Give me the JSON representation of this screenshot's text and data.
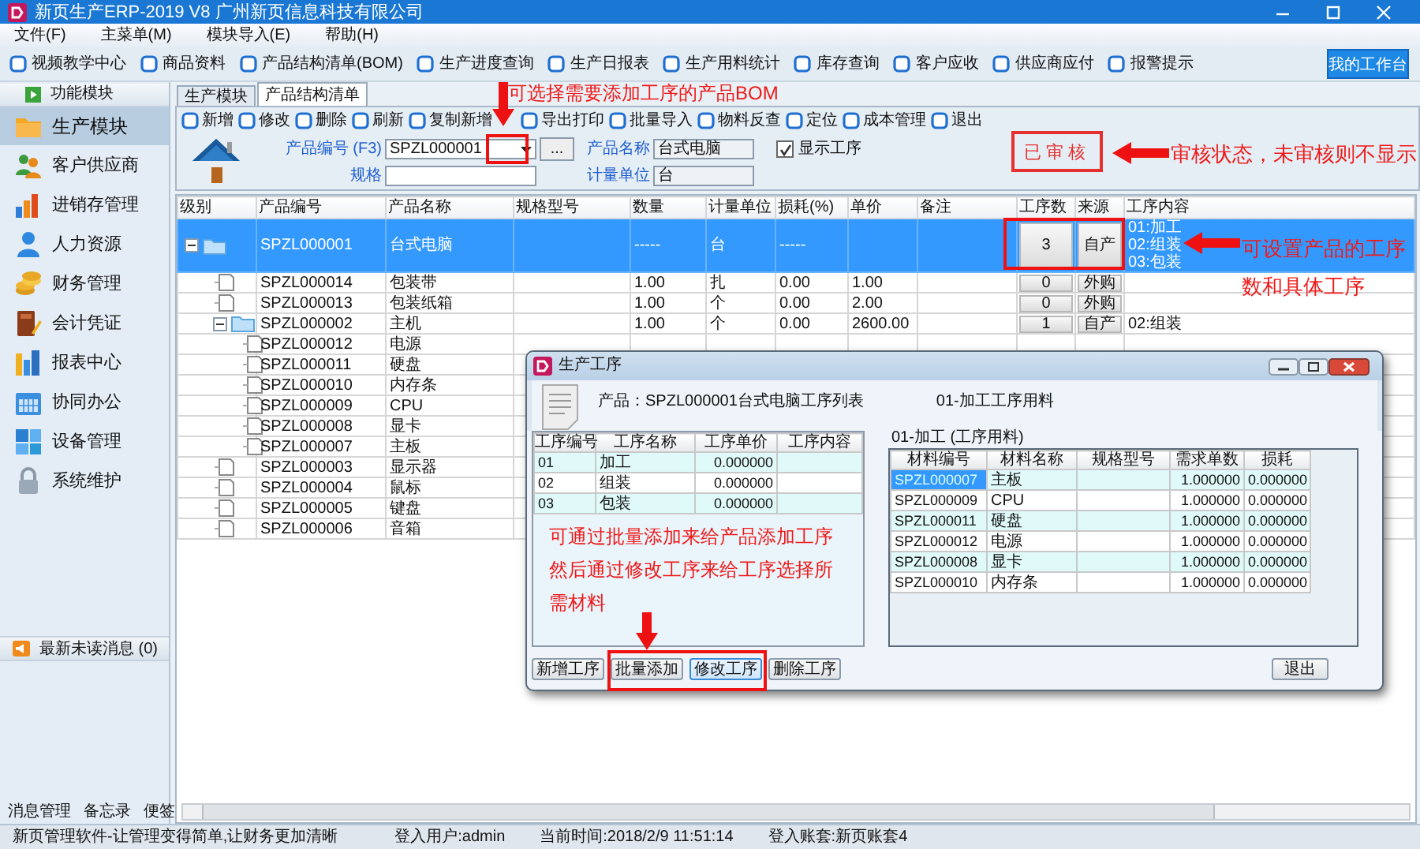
{
  "window": {
    "title": "新页生产ERP-2019 V8 广州新页信息科技有限公司"
  },
  "menu": [
    "文件(F)",
    "主菜单(M)",
    "模块导入(E)",
    "帮助(H)"
  ],
  "toolbar": [
    "视频教学中心",
    "商品资料",
    "产品结构清单(BOM)",
    "生产进度查询",
    "生产日报表",
    "生产用料统计",
    "库存查询",
    "客户应收",
    "供应商应付",
    "报警提示"
  ],
  "workbench_button": "我的工作台",
  "sidebar": {
    "header": "功能模块",
    "items": [
      {
        "label": "生产模块",
        "selected": true
      },
      {
        "label": "客户供应商",
        "selected": false
      },
      {
        "label": "进销存管理",
        "selected": false
      },
      {
        "label": "人力资源",
        "selected": false
      },
      {
        "label": "财务管理",
        "selected": false
      },
      {
        "label": "会计凭证",
        "selected": false
      },
      {
        "label": "报表中心",
        "selected": false
      },
      {
        "label": "协同办公",
        "selected": false
      },
      {
        "label": "设备管理",
        "selected": false
      },
      {
        "label": "系统维护",
        "selected": false
      }
    ],
    "message": "最新未读消息 (0)",
    "footer": [
      "消息管理",
      "备忘录",
      "便签"
    ]
  },
  "tabs": [
    {
      "label": "生产模块",
      "selected": false
    },
    {
      "label": "产品结构清单",
      "selected": true
    }
  ],
  "actions": [
    "新增",
    "修改",
    "删除",
    "刷新",
    "复制新增",
    "导出打印",
    "批量导入",
    "物料反查",
    "定位",
    "成本管理",
    "退出"
  ],
  "form": {
    "code_label": "产品编号 (F3)",
    "code": "SPZL000001",
    "picker": "...",
    "spec_label": "规格",
    "name_label": "产品名称",
    "name": "台式电脑",
    "unit_label": "计量单位",
    "unit": "台",
    "show_process": {
      "label": "显示工序",
      "checked": true
    }
  },
  "audit_stamp": "已审核",
  "table": {
    "columns": [
      "级别",
      "产品编号",
      "产品名称",
      "规格型号",
      "数量",
      "计量单位",
      "损耗(%)",
      "单价",
      "备注",
      "工序数",
      "来源",
      "工序内容"
    ],
    "rows": [
      {
        "kind": "folder",
        "code": "SPZL000001",
        "name": "台式电脑",
        "qty": "-----",
        "unit": "台",
        "loss": "-----",
        "count": "3",
        "source": "自产",
        "process": [
          "01:加工",
          "02:组装",
          "03:包装"
        ],
        "selected": true,
        "expanded": true,
        "children": [
          {
            "kind": "item",
            "code": "SPZL000014",
            "name": "包装带",
            "qty": "1.00",
            "unit": "扎",
            "loss": "0.00",
            "price": "1.00",
            "count": "0",
            "source": "外购",
            "selected": false
          },
          {
            "kind": "item",
            "code": "SPZL000013",
            "name": "包装纸箱",
            "qty": "1.00",
            "unit": "个",
            "loss": "0.00",
            "price": "2.00",
            "count": "0",
            "source": "外购",
            "selected": false
          },
          {
            "kind": "folder",
            "code": "SPZL000002",
            "name": "主机",
            "qty": "1.00",
            "unit": "个",
            "loss": "0.00",
            "price": "2600.00",
            "count": "1",
            "source": "自产",
            "process": [
              "02:组装"
            ],
            "selected": false,
            "expanded": true,
            "children": [
              {
                "kind": "item",
                "code": "SPZL000012",
                "name": "电源",
                "selected": false
              },
              {
                "kind": "item",
                "code": "SPZL000011",
                "name": "硬盘",
                "selected": false
              },
              {
                "kind": "item",
                "code": "SPZL000010",
                "name": "内存条",
                "selected": false
              },
              {
                "kind": "item",
                "code": "SPZL000009",
                "name": "CPU",
                "selected": false
              },
              {
                "kind": "item",
                "code": "SPZL000008",
                "name": "显卡",
                "selected": false
              },
              {
                "kind": "item",
                "code": "SPZL000007",
                "name": "主板",
                "selected": false
              }
            ]
          },
          {
            "kind": "item",
            "code": "SPZL000003",
            "name": "显示器",
            "selected": false
          },
          {
            "kind": "item",
            "code": "SPZL000004",
            "name": "鼠标",
            "selected": false
          },
          {
            "kind": "item",
            "code": "SPZL000005",
            "name": "键盘",
            "selected": false
          },
          {
            "kind": "item",
            "code": "SPZL000006",
            "name": "音箱",
            "selected": false
          }
        ]
      }
    ]
  },
  "dialog": {
    "title": "生产工序",
    "product_caption": "产品：SPZL000001台式电脑工序列表",
    "materials_caption": "01-加工工序用料",
    "process_table": {
      "columns": [
        "工序编号",
        "工序名称",
        "工序单价",
        "工序内容"
      ],
      "rows": [
        {
          "code": "01",
          "name": "加工",
          "price": "0.000000"
        },
        {
          "code": "02",
          "name": "组装",
          "price": "0.000000"
        },
        {
          "code": "03",
          "name": "包装",
          "price": "0.000000"
        }
      ]
    },
    "materials_label": "01-加工 (工序用料)",
    "materials_table": {
      "columns": [
        "材料编号",
        "材料名称",
        "规格型号",
        "需求单数",
        "损耗"
      ],
      "rows": [
        {
          "code": "SPZL000007",
          "name": "主板",
          "qty": "1.000000",
          "loss": "0.000000",
          "selected": true
        },
        {
          "code": "SPZL000009",
          "name": "CPU",
          "qty": "1.000000",
          "loss": "0.000000",
          "selected": false
        },
        {
          "code": "SPZL000011",
          "name": "硬盘",
          "qty": "1.000000",
          "loss": "0.000000",
          "selected": false
        },
        {
          "code": "SPZL000012",
          "name": "电源",
          "qty": "1.000000",
          "loss": "0.000000",
          "selected": false
        },
        {
          "code": "SPZL000008",
          "name": "显卡",
          "qty": "1.000000",
          "loss": "0.000000",
          "selected": false
        },
        {
          "code": "SPZL000010",
          "name": "内存条",
          "qty": "1.000000",
          "loss": "0.000000",
          "selected": false
        }
      ]
    },
    "buttons": [
      {
        "label": "新增工序",
        "focused": false
      },
      {
        "label": "批量添加",
        "focused": false
      },
      {
        "label": "修改工序",
        "focused": true
      },
      {
        "label": "删除工序",
        "focused": false
      }
    ],
    "exit_button": "退出"
  },
  "callouts": [
    {
      "text": "可选择需要添加工序的产品BOM"
    },
    {
      "text": "审核状态，未审核则不显示"
    },
    {
      "text": "可设置产品的工序数和具体工序"
    },
    {
      "text": "可通过批量添加来给产品添加工序然后通过修改工序来给工序选择所需材料"
    }
  ],
  "status_bar": [
    "新页管理软件-让管理变得简单,让财务更加清晰",
    "登入用户:admin",
    "当前时间:2018/2/9 11:51:14",
    "登入账套:新页账套4"
  ]
}
